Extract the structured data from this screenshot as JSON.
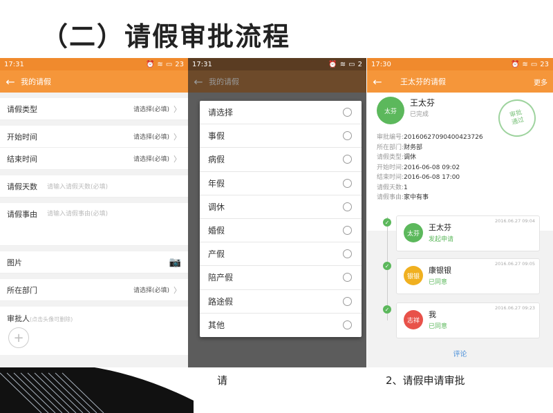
{
  "slide": {
    "title": "（二）请假审批流程",
    "caption_left_partial": "请",
    "caption_right": "2、请假申请审批"
  },
  "colors": {
    "accent": "#f5963a",
    "status_bar": "#f08a2d",
    "green": "#5cb85c",
    "orange_text": "#e08a1e",
    "link": "#4a90d9"
  },
  "phone1": {
    "status": {
      "time": "17:31",
      "battery": "23"
    },
    "appbar": {
      "title": "我的请假"
    },
    "rows": {
      "leave_type": {
        "label": "请假类型",
        "value": "请选择(必填)"
      },
      "start_time": {
        "label": "开始时间",
        "value": "请选择(必填)"
      },
      "end_time": {
        "label": "结束时间",
        "value": "请选择(必填)"
      },
      "days": {
        "label": "请假天数",
        "placeholder": "请输入请假天数(必填)"
      },
      "reason": {
        "label": "请假事由",
        "placeholder": "请输入请假事由(必填)"
      },
      "image": {
        "label": "图片"
      },
      "department": {
        "label": "所在部门",
        "value": "请选择(必填)"
      },
      "approver": {
        "label": "审批人",
        "hint": "(点击头像可删除)"
      }
    }
  },
  "phone2": {
    "status": {
      "time": "17:31",
      "battery": "2"
    },
    "appbar": {
      "title": "我的请假"
    },
    "options": [
      "请选择",
      "事假",
      "病假",
      "年假",
      "调休",
      "婚假",
      "产假",
      "陪产假",
      "路途假",
      "其他"
    ]
  },
  "phone3": {
    "status": {
      "time": "17:30",
      "battery": "23"
    },
    "appbar": {
      "title": "王太芬的请假",
      "more": "更多"
    },
    "applicant": {
      "avatar": "太芬",
      "name": "王太芬",
      "status": "已完成"
    },
    "stamp": "审批\n通过",
    "info": [
      {
        "k": "审批编号:",
        "v": "20160627090400423726"
      },
      {
        "k": "所在部门:",
        "v": "财务部"
      },
      {
        "k": "请假类型:",
        "v": "调休"
      },
      {
        "k": "开始时间:",
        "v": "2016-06-08 09:02"
      },
      {
        "k": "结束时间:",
        "v": "2016-06-08 17:00"
      },
      {
        "k": "请假天数:",
        "v": "1"
      },
      {
        "k": "请假事由:",
        "v": "家中有事"
      }
    ],
    "timeline": [
      {
        "avatar": "太芬",
        "name": "王太芬",
        "sub": "发起申请",
        "time": "2016.06.27 09:04",
        "color": "#5cb85c"
      },
      {
        "avatar": "银银",
        "name": "康银银",
        "sub": "已同意",
        "time": "2016.06.27 09:05",
        "color": "#f0b020"
      },
      {
        "avatar": "志祥",
        "name": "我",
        "sub": "已同意",
        "time": "2016.06.27 09:23",
        "color": "#e8524a"
      }
    ],
    "comment": "评论"
  }
}
